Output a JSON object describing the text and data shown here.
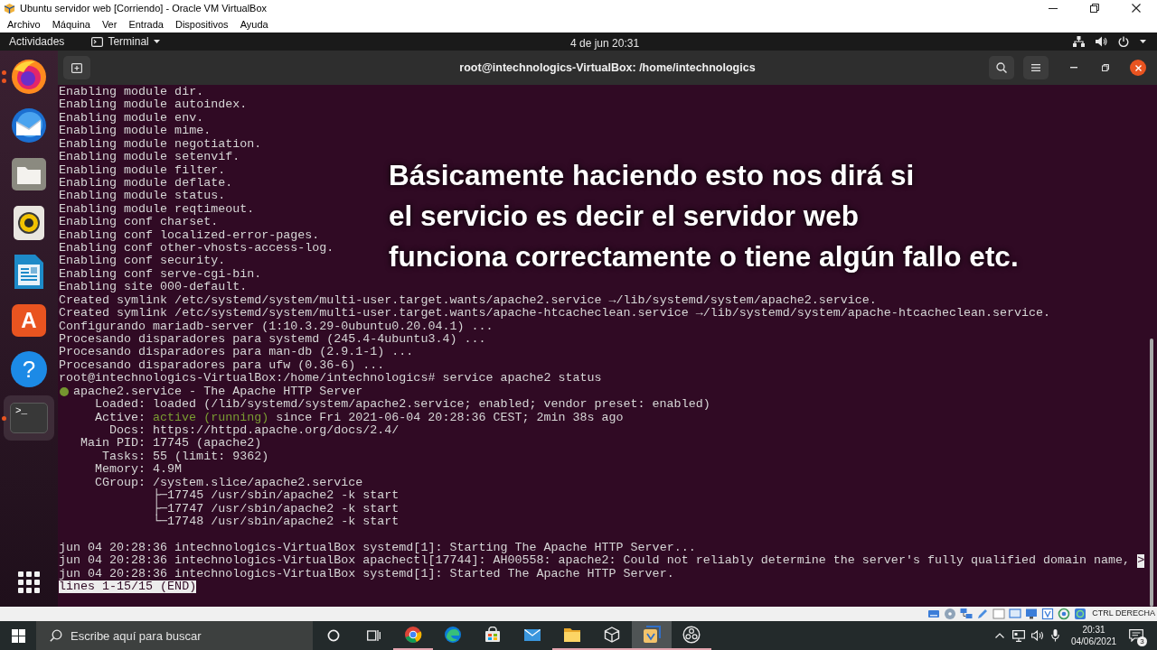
{
  "window": {
    "title": "Ubuntu servidor web [Corriendo] - Oracle VM VirtualBox"
  },
  "menu": [
    "Archivo",
    "Máquina",
    "Ver",
    "Entrada",
    "Dispositivos",
    "Ayuda"
  ],
  "top_bar": {
    "activities": "Actividades",
    "app_menu": "Terminal",
    "clock": "4 de jun 20:31"
  },
  "dock": [
    {
      "kind": "browser",
      "running": true,
      "multiple_windows": true,
      "selected": false
    },
    {
      "kind": "mail",
      "running": false,
      "multiple_windows": false,
      "selected": false
    },
    {
      "kind": "files",
      "running": false,
      "multiple_windows": false,
      "selected": false
    },
    {
      "kind": "music",
      "running": false,
      "multiple_windows": false,
      "selected": false
    },
    {
      "kind": "writer",
      "running": false,
      "multiple_windows": false,
      "selected": false
    },
    {
      "kind": "store",
      "glyph": "A",
      "running": false,
      "multiple_windows": false,
      "selected": false
    },
    {
      "kind": "help",
      "glyph": "?",
      "running": false,
      "multiple_windows": false,
      "selected": false
    },
    {
      "kind": "terminal",
      "glyph": ">_",
      "running": true,
      "multiple_windows": false,
      "selected": true
    }
  ],
  "terminal": {
    "title": "root@intechnologics-VirtualBox: /home/intechnologics",
    "lines": [
      {
        "kind": "plain",
        "text": "Enabling module dir."
      },
      {
        "kind": "plain",
        "text": "Enabling module autoindex."
      },
      {
        "kind": "plain",
        "text": "Enabling module env."
      },
      {
        "kind": "plain",
        "text": "Enabling module mime."
      },
      {
        "kind": "plain",
        "text": "Enabling module negotiation."
      },
      {
        "kind": "plain",
        "text": "Enabling module setenvif."
      },
      {
        "kind": "plain",
        "text": "Enabling module filter."
      },
      {
        "kind": "plain",
        "text": "Enabling module deflate."
      },
      {
        "kind": "plain",
        "text": "Enabling module status."
      },
      {
        "kind": "plain",
        "text": "Enabling module reqtimeout."
      },
      {
        "kind": "plain",
        "text": "Enabling conf charset."
      },
      {
        "kind": "plain",
        "text": "Enabling conf localized-error-pages."
      },
      {
        "kind": "plain",
        "text": "Enabling conf other-vhosts-access-log."
      },
      {
        "kind": "plain",
        "text": "Enabling conf security."
      },
      {
        "kind": "plain",
        "text": "Enabling conf serve-cgi-bin."
      },
      {
        "kind": "plain",
        "text": "Enabling site 000-default."
      },
      {
        "kind": "plain",
        "text": "Created symlink /etc/systemd/system/multi-user.target.wants/apache2.service →/lib/systemd/system/apache2.service."
      },
      {
        "kind": "plain",
        "text": "Created symlink /etc/systemd/system/multi-user.target.wants/apache-htcacheclean.service →/lib/systemd/system/apache-htcacheclean.service."
      },
      {
        "kind": "plain",
        "text": "Configurando mariadb-server (1:10.3.29-0ubuntu0.20.04.1) ..."
      },
      {
        "kind": "plain",
        "text": "Procesando disparadores para systemd (245.4-4ubuntu3.4) ..."
      },
      {
        "kind": "plain",
        "text": "Procesando disparadores para man-db (2.9.1-1) ..."
      },
      {
        "kind": "plain",
        "text": "Procesando disparadores para ufw (0.36-6) ..."
      },
      {
        "kind": "plain",
        "text": "root@intechnologics-VirtualBox:/home/intechnologics# service apache2 status"
      },
      {
        "kind": "service",
        "text": "apache2.service - The Apache HTTP Server"
      },
      {
        "kind": "field",
        "label": "Loaded:",
        "value": "loaded (/lib/systemd/system/apache2.service; enabled; vendor preset: enabled)"
      },
      {
        "kind": "state",
        "label": "Active:",
        "state": "active (running)",
        "value": "since Fri 2021-06-04 20:28:36 CEST; 2min 38s ago"
      },
      {
        "kind": "field",
        "label": "Docs:",
        "value": "https://httpd.apache.org/docs/2.4/"
      },
      {
        "kind": "field",
        "label": "Main PID:",
        "value": "17745 (apache2)"
      },
      {
        "kind": "field",
        "label": "Tasks:",
        "value": "55 (limit: 9362)"
      },
      {
        "kind": "field",
        "label": "Memory:",
        "value": "4.9M"
      },
      {
        "kind": "field",
        "label": "CGroup:",
        "value": "/system.slice/apache2.service"
      },
      {
        "kind": "tree",
        "text": "├─17745 /usr/sbin/apache2 -k start"
      },
      {
        "kind": "tree",
        "text": "├─17747 /usr/sbin/apache2 -k start"
      },
      {
        "kind": "tree",
        "text": "└─17748 /usr/sbin/apache2 -k start"
      },
      {
        "kind": "blank"
      },
      {
        "kind": "plain",
        "text": "jun 04 20:28:36 intechnologics-VirtualBox systemd[1]: Starting The Apache HTTP Server..."
      },
      {
        "kind": "cut",
        "text": "jun 04 20:28:36 intechnologics-VirtualBox apachectl[17744]: AH00558: apache2: Could not reliably determine the server's fully qualified domain name,",
        "marker": ">"
      },
      {
        "kind": "plain",
        "text": "jun 04 20:28:36 intechnologics-VirtualBox systemd[1]: Started The Apache HTTP Server."
      },
      {
        "kind": "pager",
        "text": "lines 1-15/15 (END)"
      }
    ]
  },
  "caption": {
    "lines": [
      "Básicamente haciendo esto nos dirá si",
      "el servicio es decir el servidor web",
      "funciona correctamente o tiene algún fallo etc."
    ]
  },
  "vbox_status": {
    "host_key": "CTRL DERECHA"
  },
  "taskbar": {
    "search": {
      "placeholder": "Escribe aquí para buscar"
    },
    "apps": [
      {
        "kind": "browser",
        "running": true,
        "selected": false
      },
      {
        "kind": "swirl",
        "running": false,
        "selected": false
      },
      {
        "kind": "bag",
        "running": false,
        "selected": false
      },
      {
        "kind": "mail",
        "running": false,
        "selected": false
      },
      {
        "kind": "folder",
        "running": true,
        "selected": false
      },
      {
        "kind": "cube",
        "running": true,
        "selected": false
      },
      {
        "kind": "box",
        "running": true,
        "selected": true
      },
      {
        "kind": "aperture",
        "running": true,
        "selected": false
      }
    ],
    "clock": {
      "time": "20:31",
      "date": "04/06/2021"
    },
    "notifications": "3"
  }
}
